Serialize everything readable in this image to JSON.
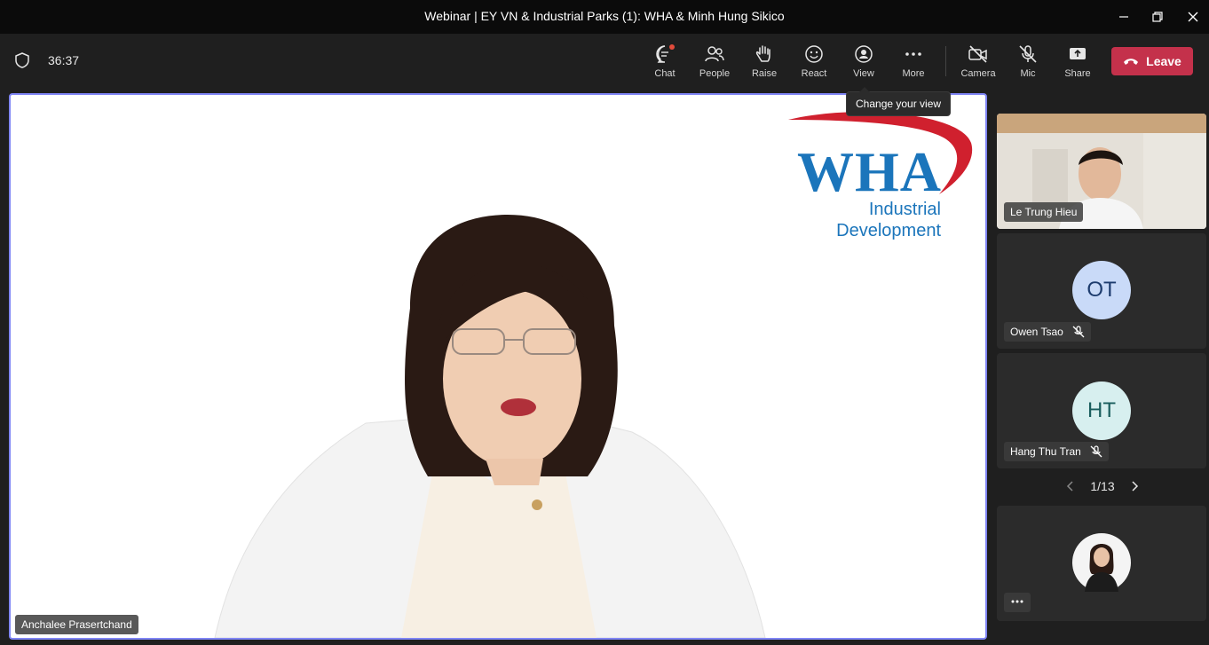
{
  "window": {
    "title": "Webinar | EY VN & Industrial Parks (1): WHA & Minh Hung Sikico"
  },
  "meeting": {
    "timer": "36:37"
  },
  "toolbar": {
    "chat": "Chat",
    "people": "People",
    "raise": "Raise",
    "react": "React",
    "view": "View",
    "more": "More",
    "camera": "Camera",
    "mic": "Mic",
    "share": "Share",
    "leave": "Leave"
  },
  "tooltip": {
    "text": "Change your view"
  },
  "stage": {
    "speaker_name": "Anchalee Prasertchand",
    "logo": {
      "wordmark": "WHA",
      "line1": "Industrial",
      "line2": "Development"
    }
  },
  "sidebar": {
    "participants": [
      {
        "name": "Le Trung Hieu",
        "type": "video"
      },
      {
        "name": "Owen Tsao",
        "initials": "OT",
        "muted": true,
        "avatar_color": "#c9daf8",
        "initials_color": "#1d3c6e"
      },
      {
        "name": "Hang Thu Tran",
        "initials": "HT",
        "muted": true,
        "avatar_color": "#d7efef",
        "initials_color": "#1a5e5e"
      },
      {
        "name": "",
        "type": "photo"
      }
    ],
    "pager": "1/13"
  },
  "colors": {
    "accent": "#7f85f5",
    "leave": "#c4314b",
    "notification": "#e24b3b",
    "brand_blue": "#1b75bb",
    "brand_red": "#d0202e"
  }
}
